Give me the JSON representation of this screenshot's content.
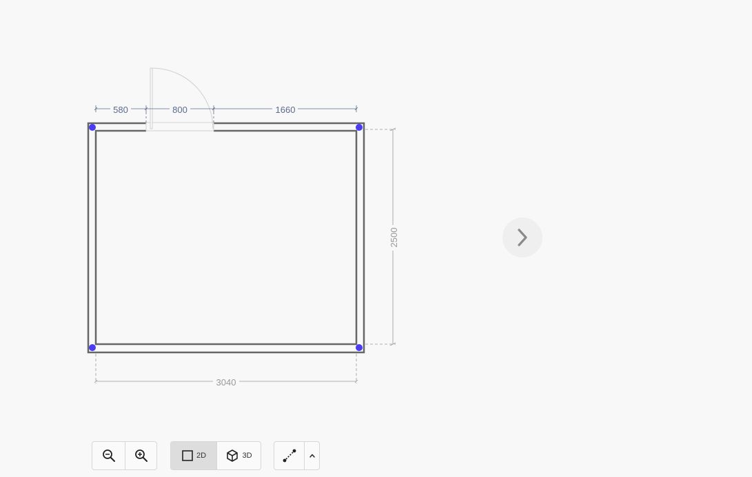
{
  "plan": {
    "dimensions": {
      "left_segment": "580",
      "door_width": "800",
      "right_segment": "1660",
      "height": "2500",
      "width": "3040"
    },
    "corner_handle_color": "#4a3cf0",
    "wall_color": "#666666",
    "dimension_top_color": "#5b6b8c",
    "dimension_other_color": "#999999"
  },
  "navigation": {
    "next_icon": "chevron-right-icon"
  },
  "toolbar": {
    "zoom_out_icon": "zoom-out-icon",
    "zoom_in_icon": "zoom-in-icon",
    "view_2d_label": "2D",
    "view_3d_label": "3D",
    "active_view": "2D",
    "measure_icon": "measure-line-icon",
    "expand_icon": "chevron-up-icon"
  }
}
